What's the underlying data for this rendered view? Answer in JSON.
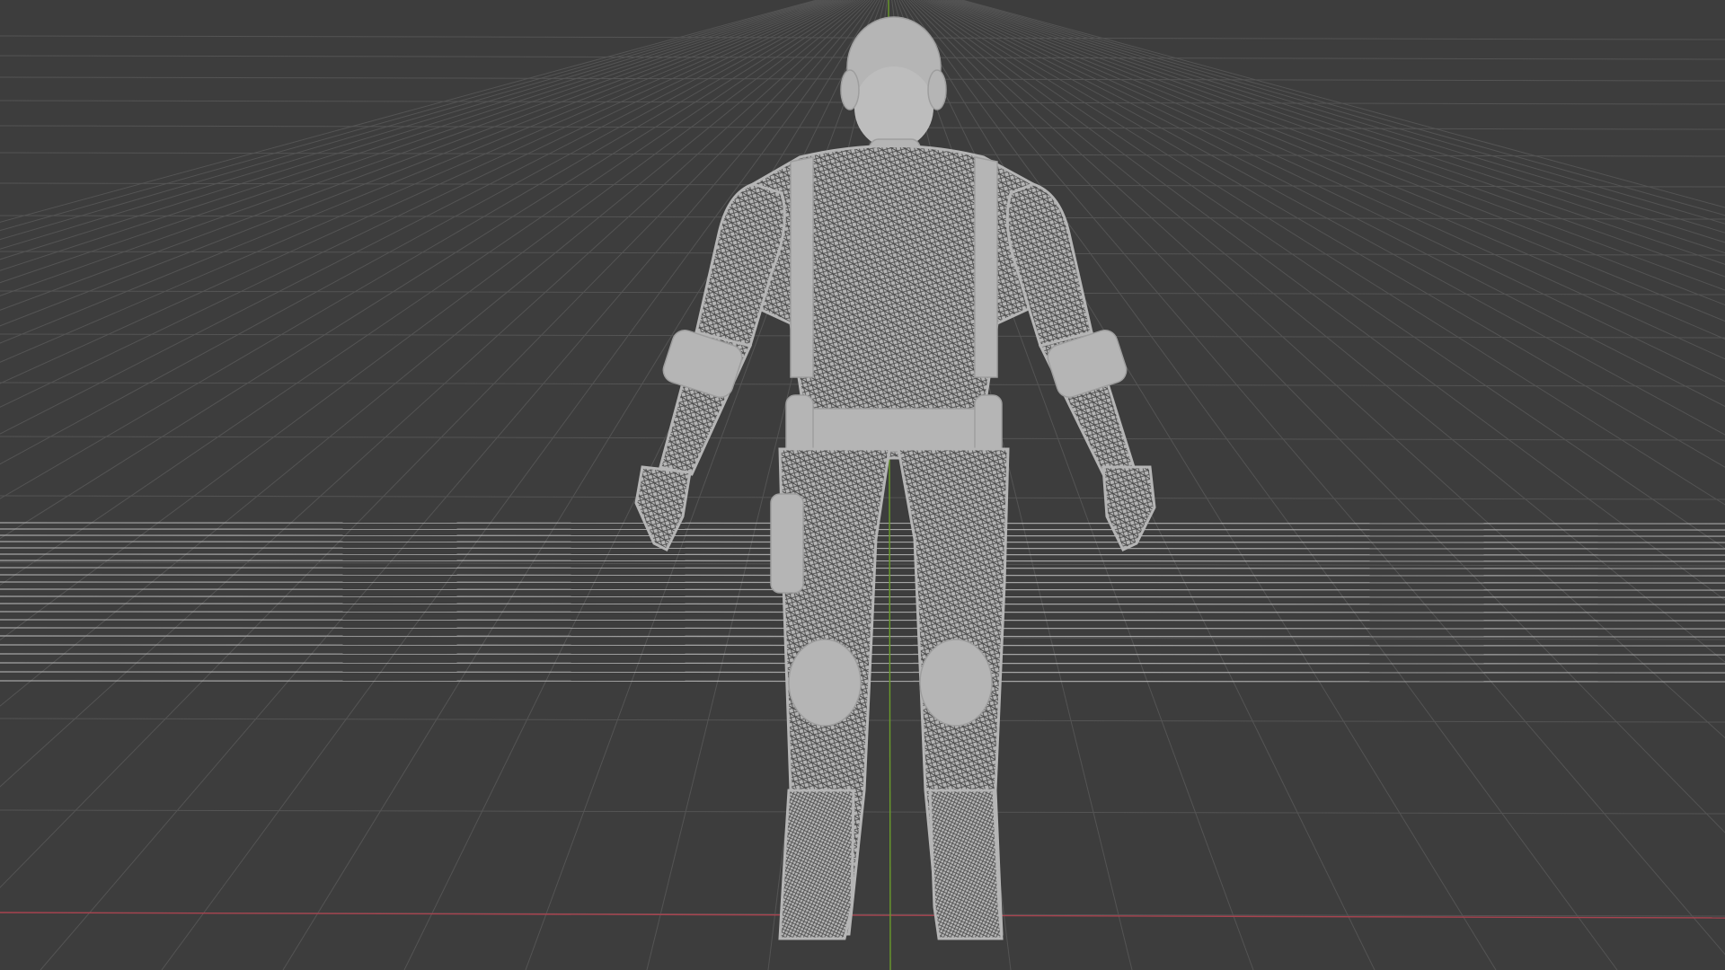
{
  "viewport": {
    "background_color": "#3d3d3d",
    "grid_color": "#545454",
    "x_axis_color": "#a8434f",
    "y_axis_color": "#6a9b2b",
    "highlight_line_color": "#c8c8c8"
  },
  "character": {
    "shading": "wireframe",
    "mesh_color": "#b5b5b5",
    "wire_color": "#4a4a4a"
  }
}
